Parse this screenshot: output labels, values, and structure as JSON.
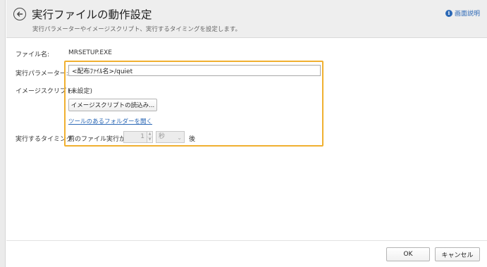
{
  "header": {
    "title": "実行ファイルの動作設定",
    "subtitle": "実行パラメーターやイメージスクリプト、実行するタイミングを設定します。",
    "help_label": "画面説明"
  },
  "form": {
    "filename": {
      "label": "ファイル名:",
      "value": "MRSETUP.EXE"
    },
    "parameter": {
      "label": "実行パラメーター:",
      "value": "<配布ﾌｧｲﾙ名>/quiet"
    },
    "image_script": {
      "label": "イメージスクリプト:",
      "value": "(未設定)",
      "load_button": "イメージスクリプトの読込み...",
      "folder_link": "ツールのあるフォルダーを開く"
    },
    "timing": {
      "label": "実行するタイミング:",
      "prefix": "前のファイル実行から",
      "amount": "1",
      "unit": "秒",
      "suffix": "後"
    }
  },
  "footer": {
    "ok_label": "OK",
    "cancel_label": "キャンセル"
  },
  "colors": {
    "highlight": "#f0b030",
    "link": "#2a67b5",
    "header_bg": "#eeeeee"
  }
}
